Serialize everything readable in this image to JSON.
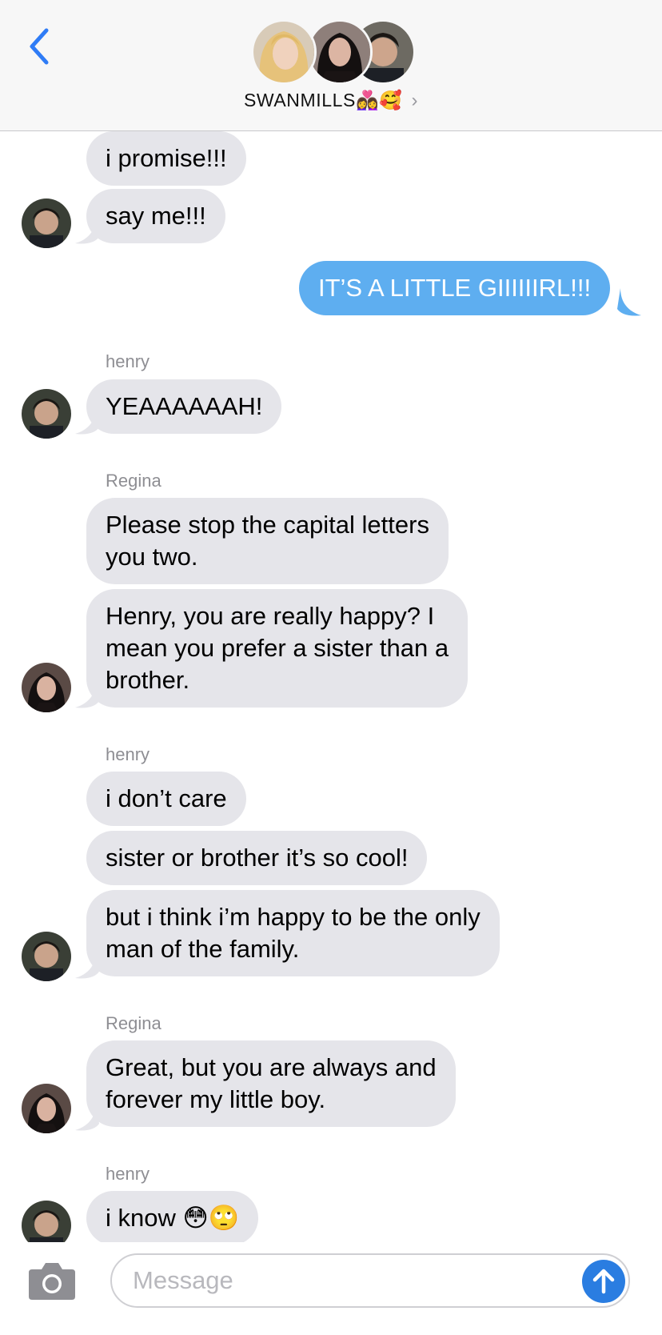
{
  "header": {
    "title": "SWANMILLS",
    "title_emojis": "👩‍❤️‍👩🥰",
    "chevron": "›",
    "participants": [
      "emma-avatar",
      "regina-avatar",
      "henry-avatar"
    ]
  },
  "messages": [
    {
      "text": "i promise!!!"
    },
    {
      "text": "say me!!!"
    },
    {
      "text": "IT’S A LITTLE GIIIIIIRL!!!"
    },
    {
      "sender": "henry",
      "text": "YEAAAAAAH!"
    },
    {
      "sender": "Regina",
      "lines": [
        "Please stop the capital letters",
        "you two."
      ]
    },
    {
      "lines": [
        "Henry, you are really happy? I",
        "mean you prefer a sister than a",
        "brother."
      ]
    },
    {
      "sender": "henry",
      "text": "i don’t care"
    },
    {
      "text": "sister or brother it’s so cool!"
    },
    {
      "lines": [
        "but i think i’m happy to be the only",
        "man of the family."
      ]
    },
    {
      "sender": "Regina",
      "lines": [
        "Great, but you are always and",
        "forever my little boy."
      ]
    },
    {
      "sender": "henry",
      "text": "i know",
      "emojis": "😳🙄"
    }
  ],
  "input": {
    "placeholder": "Message"
  },
  "colors": {
    "incoming_bubble": "#e5e5ea",
    "outgoing_bubble": "#5eaef0",
    "accent": "#2a7de1",
    "back_chevron": "#2f7cf6"
  }
}
